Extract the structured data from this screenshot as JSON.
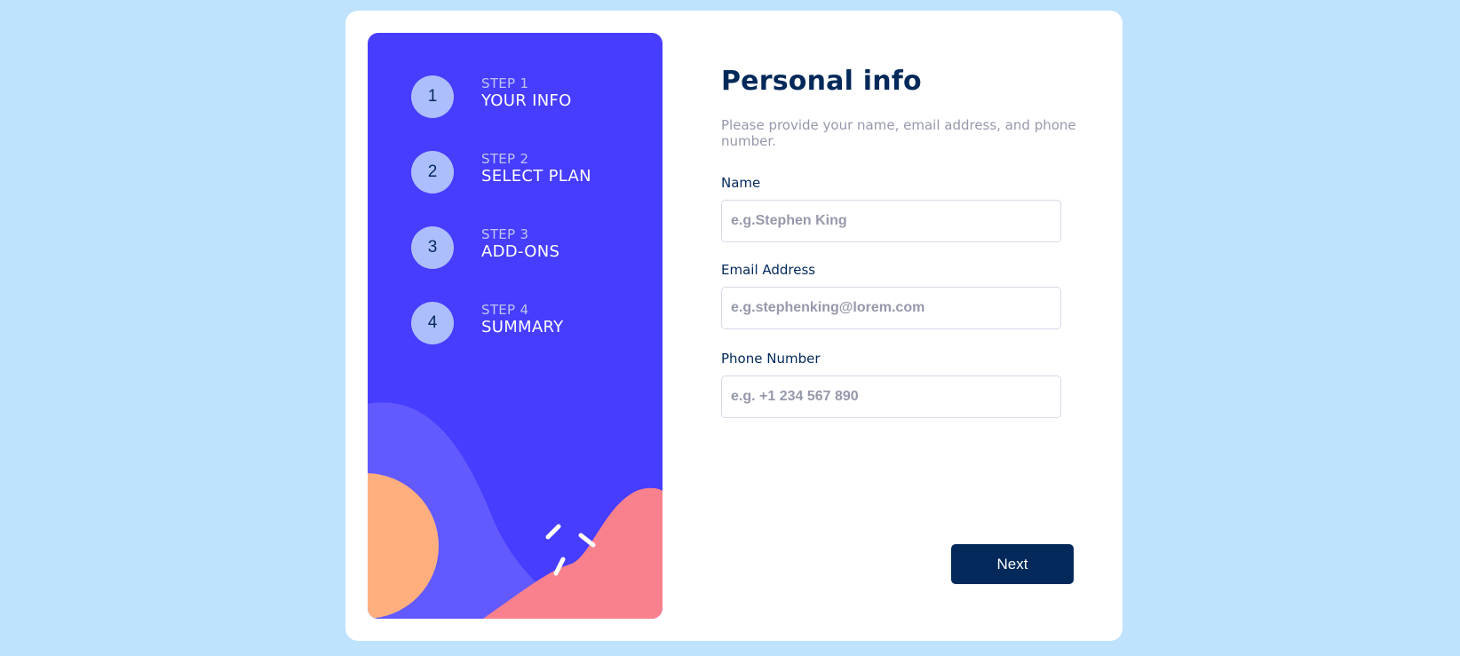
{
  "steps": [
    {
      "number": "1",
      "label": "STEP 1",
      "title": "YOUR INFO"
    },
    {
      "number": "2",
      "label": "STEP 2",
      "title": "SELECT PLAN"
    },
    {
      "number": "3",
      "label": "STEP 3",
      "title": "ADD-ONS"
    },
    {
      "number": "4",
      "label": "STEP 4",
      "title": "SUMMARY"
    }
  ],
  "form": {
    "title": "Personal info",
    "subtitle": "Please provide your name, email address, and phone number.",
    "name": {
      "label": "Name",
      "value": "",
      "placeholder": "e.g.Stephen King"
    },
    "email": {
      "label": "Email Address",
      "value": "",
      "placeholder": "e.g.stephenking@lorem.com"
    },
    "phone": {
      "label": "Phone Number",
      "value": "",
      "placeholder": "e.g. +1 234 567 890"
    },
    "next_label": "Next"
  },
  "colors": {
    "page_background": "#bfe2fd",
    "sidebar_background": "#473dff",
    "step_circle": "#adbeff",
    "title": "#02295a",
    "button": "#02295a",
    "muted_text": "#9699ab",
    "blob_orange": "#ffaf7e",
    "blob_pink": "#f9818e",
    "blob_violet": "#6259ff"
  }
}
